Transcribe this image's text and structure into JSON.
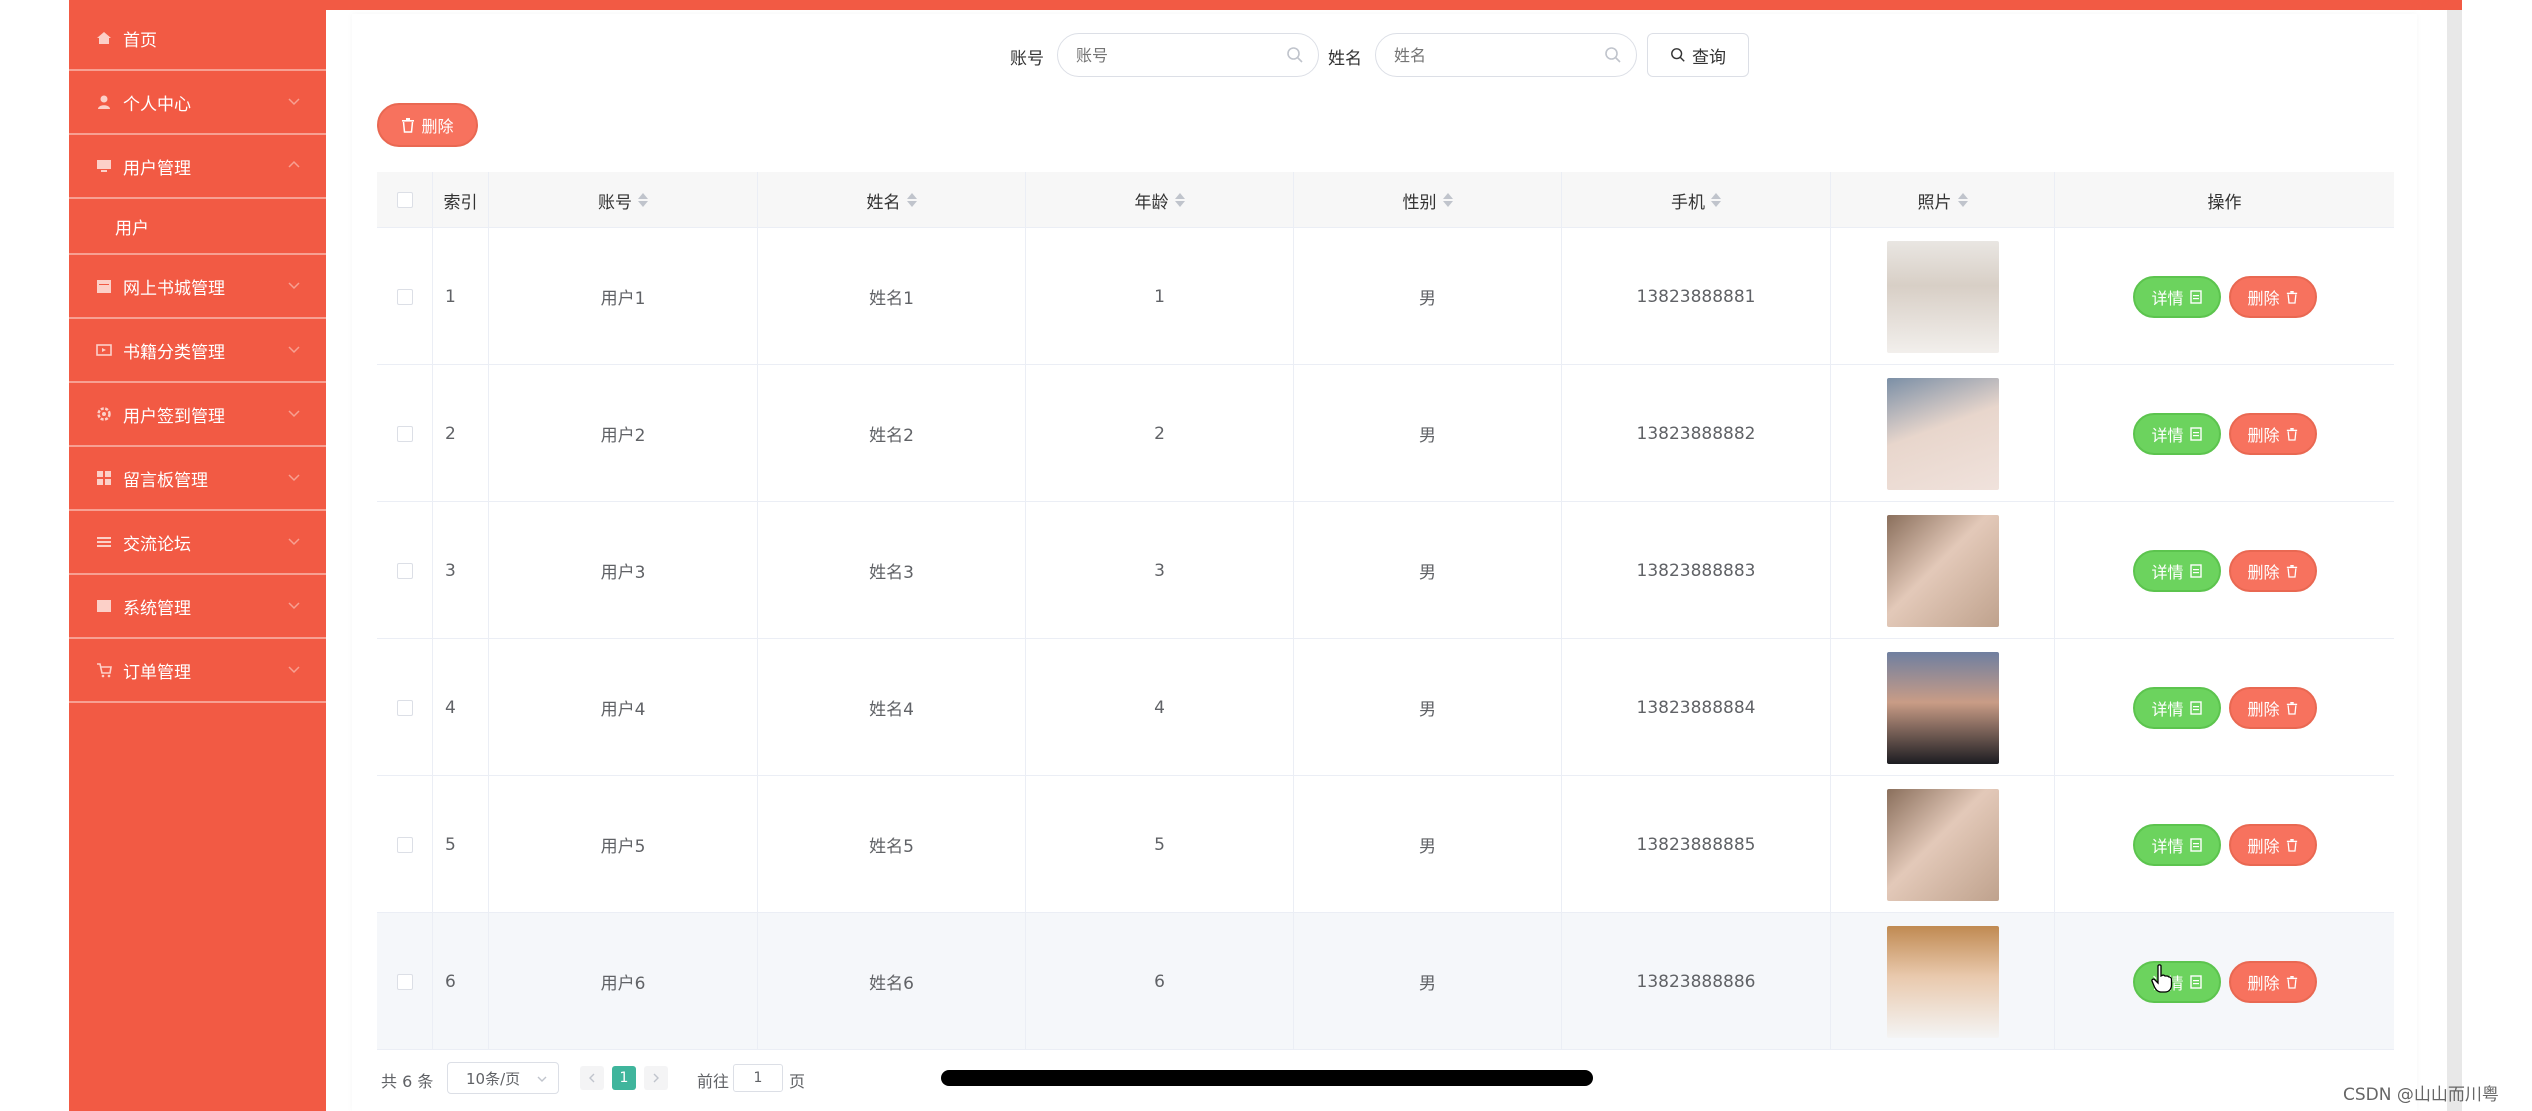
{
  "sidebar": {
    "items": [
      {
        "label": "首页",
        "icon": "home-icon"
      },
      {
        "label": "个人中心",
        "icon": "user-icon"
      },
      {
        "label": "用户管理",
        "icon": "monitor-icon"
      },
      {
        "label": "网上书城管理",
        "icon": "calendar-icon"
      },
      {
        "label": "书籍分类管理",
        "icon": "tv-icon"
      },
      {
        "label": "用户签到管理",
        "icon": "gear-icon"
      },
      {
        "label": "留言板管理",
        "icon": "grid-icon"
      },
      {
        "label": "交流论坛",
        "icon": "list-icon"
      },
      {
        "label": "系统管理",
        "icon": "box-icon"
      },
      {
        "label": "订单管理",
        "icon": "cart-icon"
      }
    ],
    "subitems": [
      {
        "label": "用户"
      }
    ]
  },
  "search": {
    "account_label": "账号",
    "account_placeholder": "账号",
    "name_label": "姓名",
    "name_placeholder": "姓名",
    "query_label": "查询"
  },
  "toolbar": {
    "delete_label": "删除"
  },
  "table": {
    "headers": [
      "索引",
      "账号",
      "姓名",
      "年龄",
      "性别",
      "手机",
      "照片",
      "操作"
    ],
    "rows": [
      {
        "index": "1",
        "account": "用户1",
        "name": "姓名1",
        "age": "1",
        "gender": "男",
        "phone": "13823888881"
      },
      {
        "index": "2",
        "account": "用户2",
        "name": "姓名2",
        "age": "2",
        "gender": "男",
        "phone": "13823888882"
      },
      {
        "index": "3",
        "account": "用户3",
        "name": "姓名3",
        "age": "3",
        "gender": "男",
        "phone": "13823888883"
      },
      {
        "index": "4",
        "account": "用户4",
        "name": "姓名4",
        "age": "4",
        "gender": "男",
        "phone": "13823888884"
      },
      {
        "index": "5",
        "account": "用户5",
        "name": "姓名5",
        "age": "5",
        "gender": "男",
        "phone": "13823888885"
      },
      {
        "index": "6",
        "account": "用户6",
        "name": "姓名6",
        "age": "6",
        "gender": "男",
        "phone": "13823888886"
      }
    ],
    "detail_label": "详情",
    "delete_label": "删除"
  },
  "pagination": {
    "total": "共 6 条",
    "page_size": "10条/页",
    "current_page": "1",
    "goto_label": "前往",
    "goto_value": "1",
    "page_suffix": "页"
  },
  "watermark": "CSDN @山山而川粤",
  "colors": {
    "accent": "#f25a44",
    "success": "#6cd35e",
    "danger": "#f7725e",
    "pager_active": "#3fb59c"
  }
}
